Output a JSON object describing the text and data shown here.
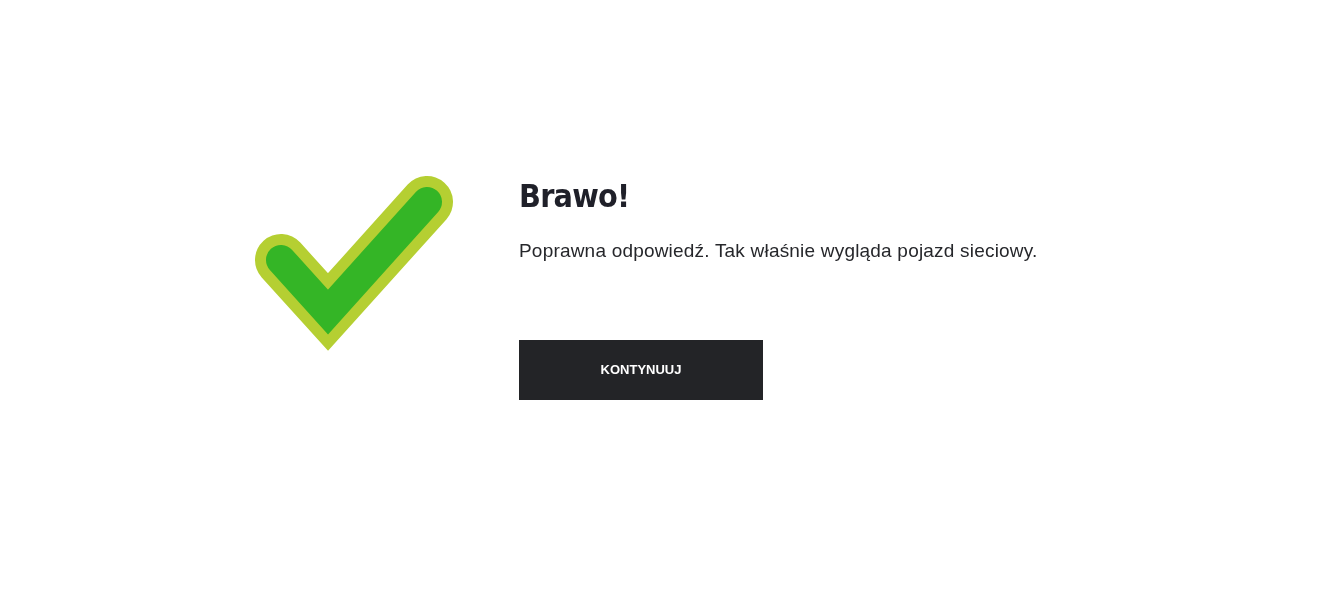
{
  "title": "Brawo!",
  "message": "Poprawna odpowiedź. Tak właśnie wygląda pojazd sieciowy.",
  "button": "KONTYNUUJ"
}
